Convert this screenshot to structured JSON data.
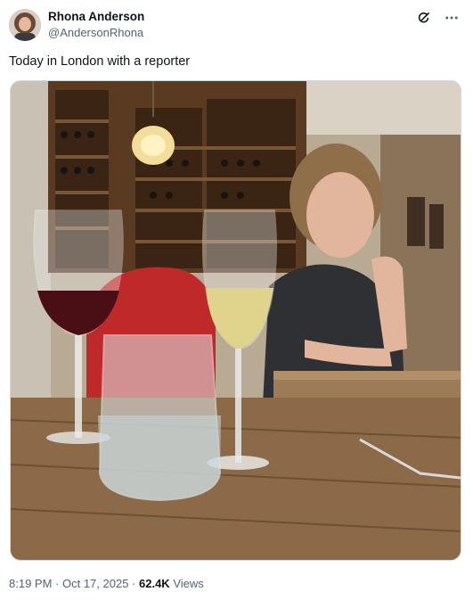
{
  "author": {
    "display_name": "Rhona Anderson",
    "handle": "@AndersonRhona"
  },
  "post": {
    "text": "Today in London with a reporter"
  },
  "meta": {
    "time": "8:19 PM",
    "separator": " · ",
    "date": "Oct 17, 2025",
    "views_count": "62.4K",
    "views_label": "Views"
  },
  "icons": {
    "grok": "grok-icon",
    "more": "more-icon"
  }
}
